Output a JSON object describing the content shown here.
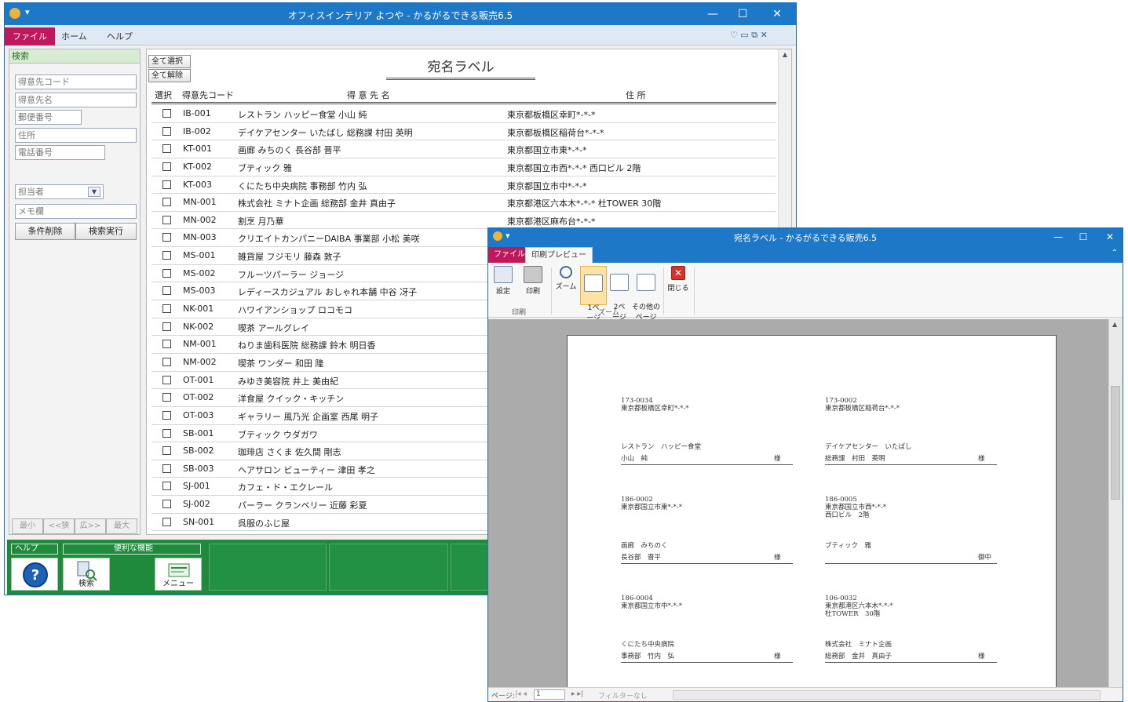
{
  "main_window": {
    "title": "オフィスインテリア よつや - かるがるできる販売6.5",
    "qa_glyph": "▾",
    "controls": {
      "min": "—",
      "max": "☐",
      "close": "✕"
    },
    "ribbon": {
      "tabs": [
        "ファイル",
        "ホーム",
        "ヘルプ"
      ],
      "right_icons": "♡ ▭ ⧉ ✕"
    },
    "search": {
      "header": "検索",
      "fields": [
        "得意先コード",
        "得意先名",
        "郵便番号",
        "住所",
        "電話番号"
      ],
      "tanto_placeholder": "担当者",
      "memo_placeholder": "メモ欄",
      "clear_button": "条件削除",
      "search_button": "検索実行",
      "nav": [
        "最小",
        "<<狭",
        "広>>",
        "最大"
      ]
    },
    "list": {
      "select_all": "全て選択",
      "deselect_all": "全て解除",
      "report_title": "宛名ラベル",
      "headers": {
        "select": "選択",
        "code": "得意先コード",
        "name": "得 意 先 名",
        "address": "住 所"
      },
      "rows": [
        {
          "code": "IB-001",
          "name": "レストラン ハッピー食堂 小山 純",
          "address": "東京都板橋区幸町*-*-*"
        },
        {
          "code": "IB-002",
          "name": "デイケアセンター いたばし 総務課 村田 英明",
          "address": "東京都板橋区稲荷台*-*-*"
        },
        {
          "code": "KT-001",
          "name": "画廊 みちのく 長谷部 晋平",
          "address": "東京都国立市東*-*-*"
        },
        {
          "code": "KT-002",
          "name": "ブティック 雅",
          "address": "東京都国立市西*-*-* 西口ビル 2階"
        },
        {
          "code": "KT-003",
          "name": "くにたち中央病院 事務部 竹内 弘",
          "address": "東京都国立市中*-*-*"
        },
        {
          "code": "MN-001",
          "name": "株式会社 ミナト企画 総務部 金井 真由子",
          "address": "東京都港区六本木*-*-* 杜TOWER 30階"
        },
        {
          "code": "MN-002",
          "name": "割烹 月乃華",
          "address": "東京都港区麻布台*-*-*"
        },
        {
          "code": "MN-003",
          "name": "クリエイトカンパニーDAIBA 事業部 小松 美咲",
          "address": ""
        },
        {
          "code": "MS-001",
          "name": "雑貨屋 フジモリ 藤森 敦子",
          "address": ""
        },
        {
          "code": "MS-002",
          "name": "フルーツパーラー ジョージ",
          "address": ""
        },
        {
          "code": "MS-003",
          "name": "レディースカジュアル おしゃれ本舗 中谷 冴子",
          "address": ""
        },
        {
          "code": "NK-001",
          "name": "ハワイアンショップ ロコモコ",
          "address": ""
        },
        {
          "code": "NK-002",
          "name": "喫茶 アールグレイ",
          "address": ""
        },
        {
          "code": "NM-001",
          "name": "ねりま歯科医院 総務課 鈴木 明日香",
          "address": ""
        },
        {
          "code": "NM-002",
          "name": "喫茶 ワンダー 和田 隆",
          "address": ""
        },
        {
          "code": "OT-001",
          "name": "みゆき美容院 井上 美由紀",
          "address": ""
        },
        {
          "code": "OT-002",
          "name": "洋食屋 クイック・キッチン",
          "address": ""
        },
        {
          "code": "OT-003",
          "name": "ギャラリー 風乃光 企画室 西尾 明子",
          "address": ""
        },
        {
          "code": "SB-001",
          "name": "ブティック ウダガワ",
          "address": ""
        },
        {
          "code": "SB-002",
          "name": "珈琲店 さくま 佐久間 剛志",
          "address": ""
        },
        {
          "code": "SB-003",
          "name": "ヘアサロン ビューティー 津田 孝之",
          "address": ""
        },
        {
          "code": "SJ-001",
          "name": "カフェ・ド・エクレール",
          "address": ""
        },
        {
          "code": "SJ-002",
          "name": "パーラー クランベリー 近藤 彩夏",
          "address": ""
        },
        {
          "code": "SN-001",
          "name": "呉服のふじ屋",
          "address": ""
        }
      ]
    },
    "footer": {
      "help_label": "ヘルプ",
      "tools_label": "便利な機能",
      "search_tile": "検索",
      "menu_tile": "メニュー"
    }
  },
  "preview_window": {
    "title": "宛名ラベル - かるがるできる販売6.5",
    "tabs": [
      "ファイル",
      "印刷プレビュー"
    ],
    "buttons": {
      "setup": "設定",
      "print": "印刷",
      "zoom": "ズーム",
      "one_page": "1ペ\nージ",
      "two_pages": "2ペ\nージ",
      "other_pages": "その他の\nページ",
      "close": "閉じる"
    },
    "groups": {
      "print": "印刷",
      "zoom": "ズーム"
    },
    "labels": [
      {
        "zip": "173-0034",
        "addr1": "東京都板橋区幸町*-*-*",
        "addr2": "",
        "name1": "レストラン　ハッピー食堂",
        "name2": "小山　純",
        "honorific": "様"
      },
      {
        "zip": "173-0002",
        "addr1": "東京都板橋区稲荷台*-*-*",
        "addr2": "",
        "name1": "デイケアセンター　いたばし",
        "name2": "総務課　村田　英明",
        "honorific": "様"
      },
      {
        "zip": "186-0002",
        "addr1": "東京都国立市東*-*-*",
        "addr2": "",
        "name1": "画廊　みちのく",
        "name2": "長谷部　晋平",
        "honorific": "様"
      },
      {
        "zip": "186-0005",
        "addr1": "東京都国立市西*-*-*",
        "addr2": "西口ビル　2階",
        "name1": "ブティック　雅",
        "name2": "",
        "honorific": "御中"
      },
      {
        "zip": "186-0004",
        "addr1": "東京都国立市中*-*-*",
        "addr2": "",
        "name1": "くにたち中央病院",
        "name2": "事務部　竹内　弘",
        "honorific": "様"
      },
      {
        "zip": "106-0032",
        "addr1": "東京都港区六本木*-*-*",
        "addr2": "杜TOWER　30階",
        "name1": "株式会社　ミナト企画",
        "name2": "総務部　金井　真由子",
        "honorific": "様"
      }
    ],
    "status": {
      "page_label": "ページ:",
      "page_value": "1",
      "filter": "フィルターなし"
    }
  }
}
